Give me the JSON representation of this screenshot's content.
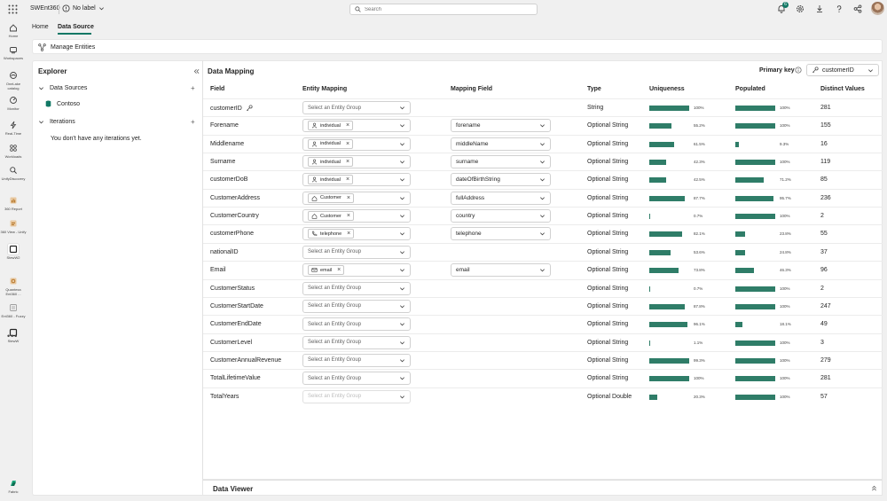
{
  "app": {
    "title": "SWEnt360",
    "sensitivity_label": "No label"
  },
  "search": {
    "placeholder": "Search"
  },
  "notifications": {
    "count": "6"
  },
  "rail": [
    {
      "label": "Home",
      "icon": "home-icon"
    },
    {
      "label": "Workspaces",
      "icon": "workspaces-icon"
    },
    {
      "label": "OneLake catalog",
      "icon": "onelake-icon"
    },
    {
      "label": "Monitor",
      "icon": "monitor-icon"
    },
    {
      "label": "Real-Time",
      "icon": "realtime-icon"
    },
    {
      "label": "Workloads",
      "icon": "workloads-icon"
    },
    {
      "label": "UnifyDiscovery",
      "icon": "discovery-icon"
    },
    {
      "label": "360 Report",
      "icon": "report-icon"
    },
    {
      "label": "360 View - Unify",
      "icon": "view-icon"
    },
    {
      "label": "StewW2",
      "icon": "item-icon"
    },
    {
      "label": "Quantexa Ent360 ...",
      "icon": "quantexa-icon"
    },
    {
      "label": "Ent360 - Fuzzy",
      "icon": "fuzzy-icon"
    },
    {
      "label": "StewW",
      "icon": "item-icon"
    },
    {
      "label": "Fabric",
      "icon": "fabric-icon"
    }
  ],
  "tabs": {
    "home": "Home",
    "data_source": "Data Source"
  },
  "toolbar": {
    "manage_entities": "Manage Entities"
  },
  "explorer": {
    "title": "Explorer",
    "data_sources_label": "Data Sources",
    "source_name": "Contoso",
    "iterations_label": "Iterations",
    "empty_iterations": "You don't have any iterations yet."
  },
  "mapping": {
    "title": "Data Mapping",
    "primary_key_label": "Primary key",
    "primary_key_value": "customerID",
    "headers": {
      "field": "Field",
      "entity": "Entity Mapping",
      "mapping_field": "Mapping Field",
      "type": "Type",
      "uniqueness": "Uniqueness",
      "populated": "Populated",
      "distinct": "Distinct Values"
    },
    "entity_placeholder": "Select an Entity Group",
    "rows": [
      {
        "field": "customerID",
        "key": true,
        "entity": "",
        "entity_icon": "",
        "mapping": "",
        "type": "String",
        "uniq": 100,
        "uniq_label": "100%",
        "pop": 100,
        "pop_label": "100%",
        "distinct": "281"
      },
      {
        "field": "Forename",
        "entity": "individual",
        "entity_icon": "person-icon",
        "mapping": "forename",
        "type": "Optional String",
        "uniq": 55.2,
        "uniq_label": "55.2%",
        "pop": 100,
        "pop_label": "100%",
        "distinct": "155"
      },
      {
        "field": "Middlename",
        "entity": "individual",
        "entity_icon": "person-icon",
        "mapping": "middleName",
        "type": "Optional String",
        "uniq": 61.5,
        "uniq_label": "61.5%",
        "pop": 9.3,
        "pop_label": "9.3%",
        "distinct": "16"
      },
      {
        "field": "Surname",
        "entity": "individual",
        "entity_icon": "person-icon",
        "mapping": "surname",
        "type": "Optional String",
        "uniq": 42.3,
        "uniq_label": "42.3%",
        "pop": 100,
        "pop_label": "100%",
        "distinct": "119"
      },
      {
        "field": "customerDoB",
        "entity": "individual",
        "entity_icon": "person-icon",
        "mapping": "dateOfBirthString",
        "type": "Optional String",
        "uniq": 42.5,
        "uniq_label": "42.5%",
        "pop": 71.2,
        "pop_label": "71.2%",
        "distinct": "85"
      },
      {
        "field": "CustomerAddress",
        "entity": "Customer",
        "entity_icon": "home-icon",
        "mapping": "fullAddress",
        "type": "Optional String",
        "uniq": 87.7,
        "uniq_label": "87.7%",
        "pop": 95.7,
        "pop_label": "95.7%",
        "distinct": "236"
      },
      {
        "field": "CustomerCountry",
        "entity": "Customer",
        "entity_icon": "home-icon",
        "mapping": "country",
        "type": "Optional String",
        "uniq": 0.7,
        "uniq_label": "0.7%",
        "pop": 100,
        "pop_label": "100%",
        "distinct": "2"
      },
      {
        "field": "customerPhone",
        "entity": "telephone",
        "entity_icon": "phone-icon",
        "mapping": "telephone",
        "type": "Optional String",
        "uniq": 82.1,
        "uniq_label": "82.1%",
        "pop": 23.8,
        "pop_label": "23.8%",
        "distinct": "55"
      },
      {
        "field": "nationalID",
        "entity": "",
        "entity_icon": "",
        "mapping": "",
        "type": "Optional String",
        "uniq": 53.6,
        "uniq_label": "53.6%",
        "pop": 24.8,
        "pop_label": "24.8%",
        "distinct": "37"
      },
      {
        "field": "Email",
        "entity": "email",
        "entity_icon": "mail-icon",
        "mapping": "email",
        "type": "Optional String",
        "uniq": 73.8,
        "uniq_label": "73.8%",
        "pop": 46.3,
        "pop_label": "46.3%",
        "distinct": "96"
      },
      {
        "field": "CustomerStatus",
        "entity": "",
        "entity_icon": "",
        "mapping": "",
        "type": "Optional String",
        "uniq": 0.7,
        "uniq_label": "0.7%",
        "pop": 100,
        "pop_label": "100%",
        "distinct": "2"
      },
      {
        "field": "CustomerStartDate",
        "entity": "",
        "entity_icon": "",
        "mapping": "",
        "type": "Optional String",
        "uniq": 87.8,
        "uniq_label": "87.8%",
        "pop": 100,
        "pop_label": "100%",
        "distinct": "247"
      },
      {
        "field": "CustomerEndDate",
        "entity": "",
        "entity_icon": "",
        "mapping": "",
        "type": "Optional String",
        "uniq": 96.1,
        "uniq_label": "96.1%",
        "pop": 18.1,
        "pop_label": "18.1%",
        "distinct": "49"
      },
      {
        "field": "CustomerLevel",
        "entity": "",
        "entity_icon": "",
        "mapping": "",
        "type": "Optional String",
        "uniq": 1.1,
        "uniq_label": "1.1%",
        "pop": 100,
        "pop_label": "100%",
        "distinct": "3"
      },
      {
        "field": "CustomerAnnualRevenue",
        "entity": "",
        "entity_icon": "",
        "mapping": "",
        "type": "Optional String",
        "uniq": 99.3,
        "uniq_label": "99.3%",
        "pop": 100,
        "pop_label": "100%",
        "distinct": "279"
      },
      {
        "field": "TotalLifetimeValue",
        "entity": "",
        "entity_icon": "",
        "mapping": "",
        "type": "Optional String",
        "uniq": 100,
        "uniq_label": "100%",
        "pop": 100,
        "pop_label": "100%",
        "distinct": "281"
      },
      {
        "field": "TotalYears",
        "entity": "",
        "entity_icon": "",
        "mapping": "",
        "type": "Optional Double",
        "uniq": 20.3,
        "uniq_label": "20.3%",
        "pop": 100,
        "pop_label": "100%",
        "distinct": "57",
        "entity_disabled": true
      }
    ]
  },
  "viewer": {
    "title": "Data Viewer"
  },
  "colors": {
    "accent": "#117865",
    "bar": "#2f7d68"
  }
}
